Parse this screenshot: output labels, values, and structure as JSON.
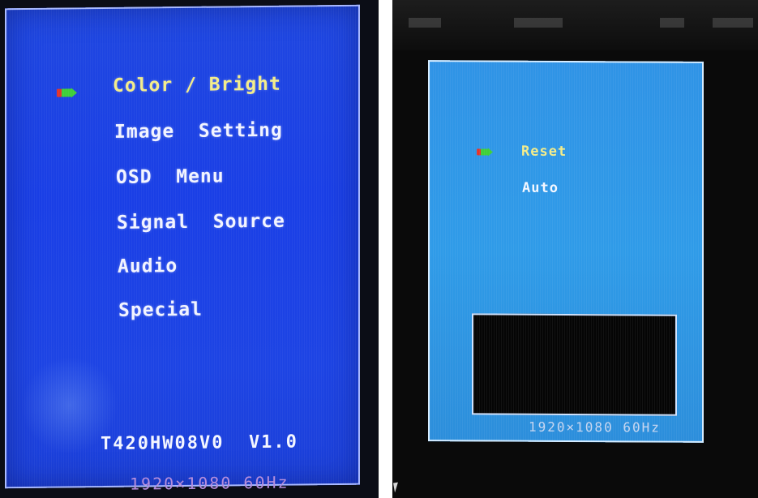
{
  "left_osd": {
    "menu": [
      {
        "label": "Color / Bright",
        "selected": true
      },
      {
        "label": "Image  Setting",
        "selected": false
      },
      {
        "label": "OSD  Menu",
        "selected": false
      },
      {
        "label": "Signal  Source",
        "selected": false
      },
      {
        "label": "Audio",
        "selected": false
      },
      {
        "label": "Special",
        "selected": false
      }
    ],
    "version": "T420HW08V0  V1.0",
    "resolution": "1920×1080  60Hz"
  },
  "right_osd": {
    "menu": [
      {
        "label": "Reset",
        "selected": true
      },
      {
        "label": "Auto",
        "selected": false
      }
    ],
    "resolution": "1920×1080  60Hz"
  },
  "colors": {
    "osd_left_bg": "#1d44e4",
    "osd_right_bg": "#2f97e6",
    "selected_text": "#f3ec8a",
    "normal_text": "#f2f4ff",
    "cursor_red": "#e2342c",
    "cursor_green": "#3fcf3a"
  },
  "icons": [
    "selection-cursor-icon",
    "mouse-pointer-icon"
  ]
}
